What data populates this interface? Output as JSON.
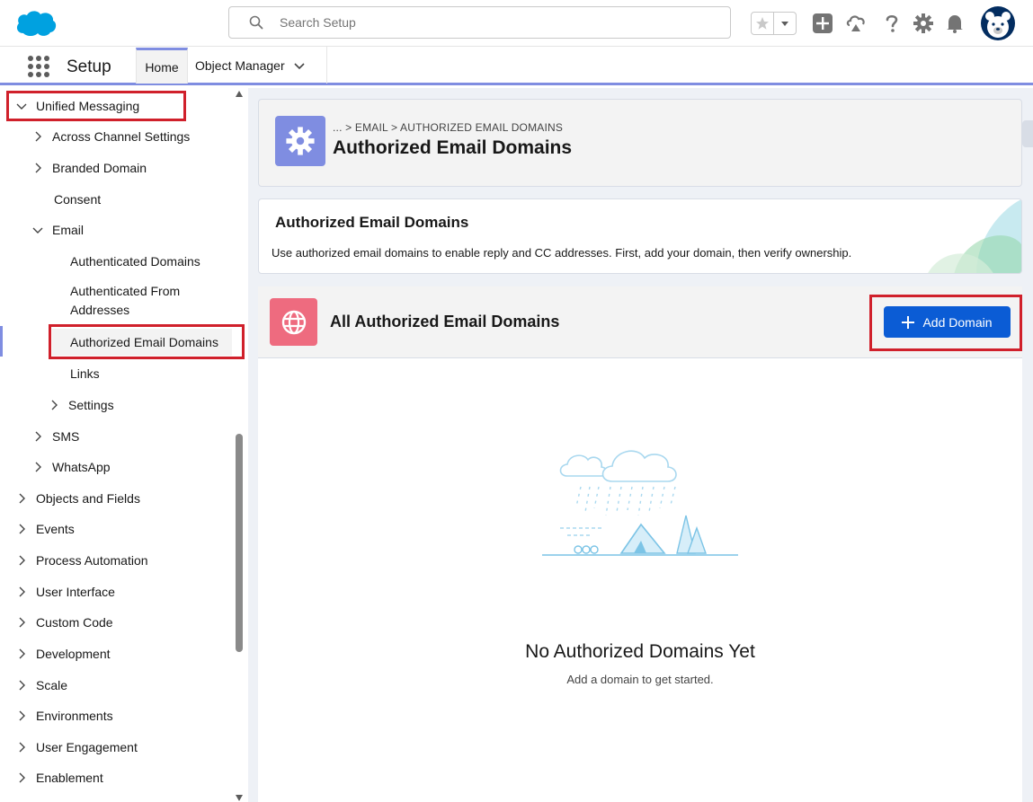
{
  "header": {
    "search_placeholder": "Search Setup"
  },
  "context_bar": {
    "app_name": "Setup",
    "tabs": [
      {
        "label": "Home"
      },
      {
        "label": "Object Manager"
      }
    ]
  },
  "sidebar": {
    "items": [
      {
        "label": "Unified Messaging"
      },
      {
        "label": "Across Channel Settings"
      },
      {
        "label": "Branded Domain"
      },
      {
        "label": "Consent"
      },
      {
        "label": "Email"
      },
      {
        "label": "Authenticated Domains"
      },
      {
        "label": "Authenticated From Addresses"
      },
      {
        "label": "Authorized Email Domains"
      },
      {
        "label": "Links"
      },
      {
        "label": "Settings"
      },
      {
        "label": "SMS"
      },
      {
        "label": "WhatsApp"
      },
      {
        "label": "Objects and Fields"
      },
      {
        "label": "Events"
      },
      {
        "label": "Process Automation"
      },
      {
        "label": "User Interface"
      },
      {
        "label": "Custom Code"
      },
      {
        "label": "Development"
      },
      {
        "label": "Scale"
      },
      {
        "label": "Environments"
      },
      {
        "label": "User Engagement"
      },
      {
        "label": "Enablement"
      }
    ]
  },
  "page_header": {
    "breadcrumb": "... > EMAIL > AUTHORIZED EMAIL DOMAINS",
    "title": "Authorized Email Domains"
  },
  "info_card": {
    "title": "Authorized Email Domains",
    "description": "Use authorized email domains to enable reply and CC addresses. First, add your domain, then verify ownership."
  },
  "list": {
    "title": "All Authorized Email Domains",
    "add_button_label": "Add Domain",
    "empty_title": "No Authorized Domains Yet",
    "empty_subtitle": "Add a domain to get started."
  },
  "colors": {
    "brand_blue": "#0b5cd5",
    "setup_tile": "#7f8de1",
    "globe_tile": "#ee6b7f",
    "highlight_red": "#d0202b"
  }
}
